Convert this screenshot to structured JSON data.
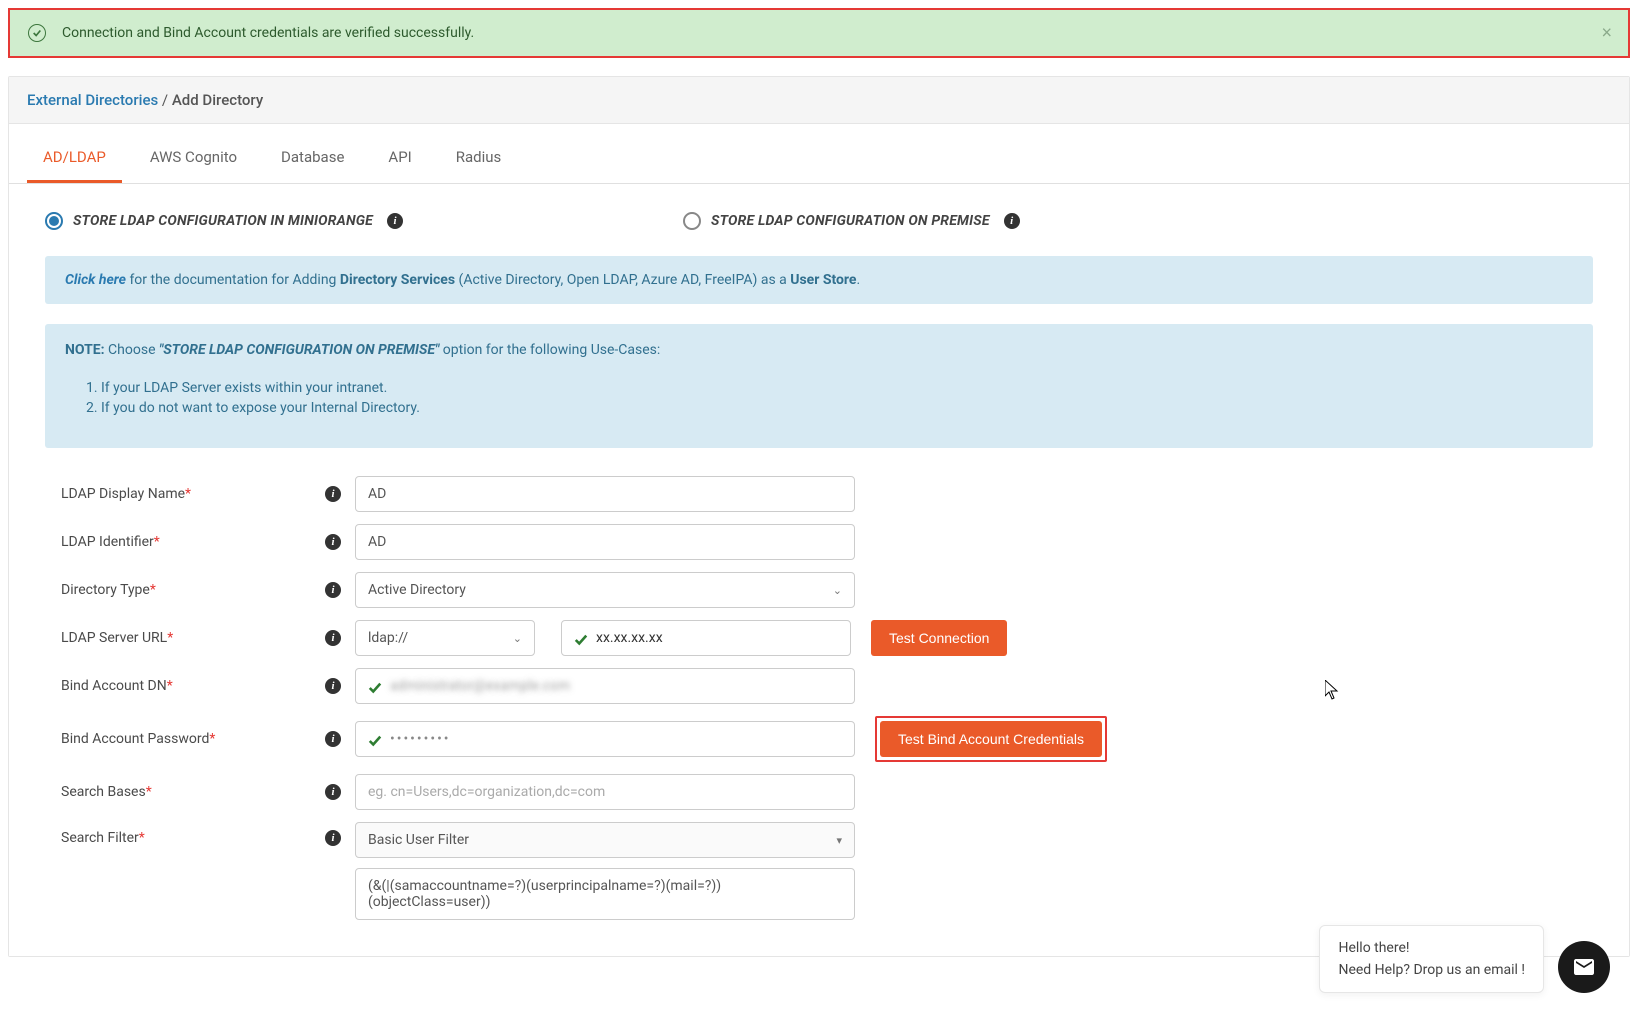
{
  "alert": {
    "message": "Connection and Bind Account credentials are verified successfully."
  },
  "breadcrumb": {
    "root": "External Directories",
    "separator": " / ",
    "current": "Add Directory"
  },
  "tabs": [
    "AD/LDAP",
    "AWS Cognito",
    "Database",
    "API",
    "Radius"
  ],
  "radios": {
    "option1": "STORE LDAP CONFIGURATION IN MINIORANGE",
    "option2": "STORE LDAP CONFIGURATION ON PREMISE"
  },
  "doc_info": {
    "click_here": "Click here",
    "pre": " for the documentation for Adding ",
    "ds": "Directory Services",
    "mid": " (Active Directory, Open LDAP, Azure AD, FreeIPA) as a ",
    "us": "User Store",
    "end": "."
  },
  "note": {
    "label": "NOTE:",
    "pre": "  Choose ",
    "quote": "\"STORE LDAP CONFIGURATION ON PREMISE\"",
    "post": " option for the following Use-Cases:",
    "items": [
      "If your LDAP Server exists within your intranet.",
      "If you do not want to expose your Internal Directory."
    ]
  },
  "form": {
    "display_name": {
      "label": "LDAP Display Name",
      "value": "AD"
    },
    "identifier": {
      "label": "LDAP Identifier",
      "value": "AD"
    },
    "directory_type": {
      "label": "Directory Type",
      "value": "Active Directory"
    },
    "server_url": {
      "label": "LDAP Server URL",
      "protocol": "ldap://",
      "host_hidden": "xx.xx.xx.xx",
      "test_btn": "Test Connection"
    },
    "bind_dn": {
      "label": "Bind Account DN",
      "value_hidden": "administrator@example.com"
    },
    "bind_pw": {
      "label": "Bind Account Password",
      "value": "•••••••••",
      "test_btn": "Test Bind Account Credentials"
    },
    "search_bases": {
      "label": "Search Bases",
      "placeholder": "eg. cn=Users,dc=organization,dc=com"
    },
    "search_filter": {
      "label": "Search Filter",
      "select": "Basic User Filter",
      "expr": "(&(|(samaccountname=?)(userprincipalname=?)(mail=?))(objectClass=user))"
    }
  },
  "chat": {
    "line1": "Hello there!",
    "line2": "Need Help? Drop us an email !"
  }
}
